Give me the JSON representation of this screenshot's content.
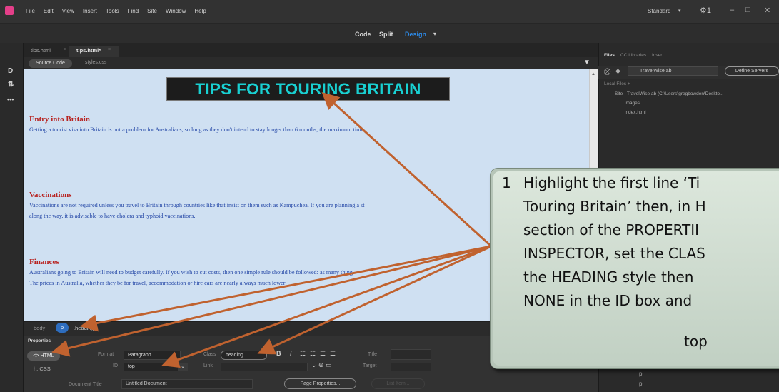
{
  "menubar": {
    "items": [
      "File",
      "Edit",
      "View",
      "Insert",
      "Tools",
      "Find",
      "Site",
      "Window",
      "Help"
    ],
    "workspace": "Standard",
    "workspace_arrow": "▾",
    "gear": "⚙1",
    "minimize": "–",
    "maximize": "□",
    "close": "✕"
  },
  "viewbar": {
    "code": "Code",
    "split": "Split",
    "design": "Design",
    "arrow": "▾"
  },
  "left_toolbar": {
    "icon1": "D",
    "icon2": "⇅",
    "icon3": "•••"
  },
  "tabs": [
    {
      "label": "tips.html",
      "close": "×"
    },
    {
      "label": "tips.html*",
      "close": "×"
    }
  ],
  "related_files": {
    "source_code": "Source Code",
    "styles": "styles.css"
  },
  "document": {
    "heading": "TIPS FOR TOURING BRITAIN",
    "sections": [
      {
        "title": "Entry into Britain",
        "lines": [
          "Getting a tourist visa into Britain is not a problem for Australians, so long as they don't intend to stay longer than 6 months, the maximum time"
        ]
      },
      {
        "title": "Vaccinations",
        "lines": [
          "Vaccinations are not required unless you travel to Britain through countries like that insist on them such as Kampuchea. If you are planning a st",
          "along the way, it is advisable to have cholera and typhoid vaccinations."
        ]
      },
      {
        "title": "Finances",
        "lines": [
          "Australians going to Britain will need to budget carefully. If you wish to cut costs, then one simple rule should be followed: as many thing",
          "The prices in Australia, whether they be for travel, accommodation or hire cars are nearly always much lower"
        ]
      }
    ]
  },
  "tag_selector": {
    "body": "body",
    "p": "p",
    "heading": ".heading"
  },
  "properties": {
    "title": "Properties",
    "html_btn": "<> HTML",
    "css_btn": "h. CSS",
    "format_label": "Format",
    "format_value": "Paragraph",
    "class_label": "Class",
    "class_value": "heading",
    "bold": "B",
    "italic": "I",
    "ul": "☷",
    "ol": "☷",
    "outdent": "☰",
    "indent": "☰",
    "title_label": "Title",
    "id_label": "ID",
    "id_value": "top",
    "id_arrow": "⌄",
    "link_label": "Link",
    "link_icons": "⌄ ⊕ ▭",
    "target_label": "Target",
    "doc_title_label": "Document Title",
    "doc_title_value": "Untitled Document",
    "page_properties": "Page Properties...",
    "list_item": "List Item..."
  },
  "files_panel": {
    "tabs": [
      "Files",
      "CC Libraries",
      "Insert"
    ],
    "site": "TravelWise ab",
    "define_servers": "Define Servers",
    "local_files": "Local Files  +",
    "tree": [
      "Site - TravelWise ab (C:\\Users\\gregbowden\\Deskto...",
      "images",
      "index.html"
    ],
    "bottom_items": [
      "p",
      "p"
    ]
  },
  "callout": {
    "number": "1",
    "lines": [
      "Highlight the first line ‘Ti",
      "Touring Britain’ then, in H",
      "section of the PROPERTII",
      "INSPECTOR, set the CLAS",
      "the HEADING style then",
      "NONE in the ID box and"
    ],
    "final": "top"
  },
  "colors": {
    "arrow": "#c0622f",
    "heading_text": "#19d0d2",
    "section_title": "#b8221f",
    "body_text": "#2346a6",
    "design_bg": "#cfe0f2",
    "accent": "#2d8ceb"
  }
}
